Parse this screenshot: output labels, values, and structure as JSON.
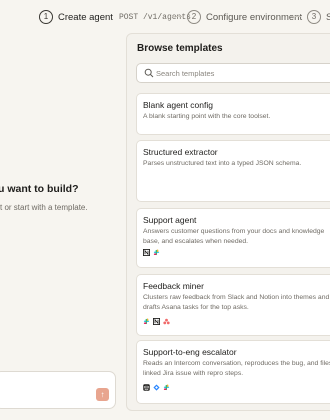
{
  "stepper": {
    "steps": [
      {
        "num": "1",
        "label": "Create agent",
        "path": "POST /v1/agents"
      },
      {
        "num": "2",
        "label": "Configure environment"
      },
      {
        "num": "3",
        "label": "St"
      }
    ]
  },
  "hero": {
    "title": "u want to build?",
    "subtitle": "t or start with a template."
  },
  "panel": {
    "title": "Browse templates",
    "search_placeholder": "Search templates"
  },
  "templates": [
    {
      "name": "Blank agent config",
      "desc": "A blank starting point with the core toolset.",
      "icons": []
    },
    {
      "name": "Structured extractor",
      "desc": "Parses unstructured text into a typed JSON schema.",
      "icons": []
    },
    {
      "name": "Support agent",
      "desc": "Answers customer questions from your docs and knowledge base, and escalates when needed.",
      "icons": [
        "notion-icon",
        "slack-icon"
      ]
    },
    {
      "name": "Feedback miner",
      "desc": "Clusters raw feedback from Slack and Notion into themes and drafts Asana tasks for the top asks.",
      "icons": [
        "slack-icon",
        "notion-icon",
        "asana-icon"
      ]
    },
    {
      "name": "Support-to-eng escalator",
      "desc": "Reads an Intercom conversation, reproduces the bug, and files a linked Jira issue with repro steps.",
      "icons": [
        "intercom-icon",
        "jira-icon",
        "slack-icon"
      ]
    }
  ],
  "colors": {
    "accent": "#e8a58f",
    "background": "#f7f5f0"
  }
}
